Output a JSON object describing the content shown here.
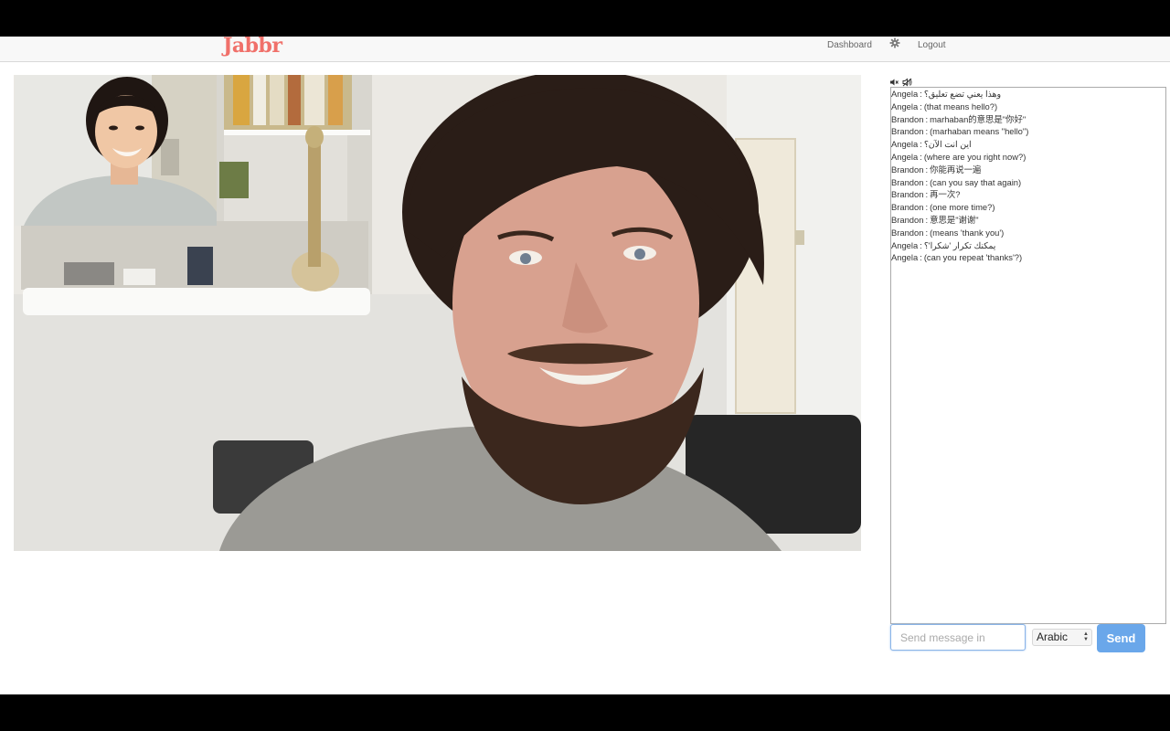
{
  "app": {
    "brand": "Jabbr"
  },
  "nav": {
    "dashboard": "Dashboard",
    "settings_icon": "gear-icon",
    "logout": "Logout"
  },
  "audio_controls": {
    "mute_icon": "speaker-mute-icon",
    "video_icon": "video-off-icon"
  },
  "chat": {
    "messages": [
      {
        "sender": "Angela",
        "text": "وهذا يعني تضع تعليق؟"
      },
      {
        "sender": "Angela",
        "text": "(that means hello?)"
      },
      {
        "sender": "Brandon",
        "text": "marhaban的意思是\"你好\""
      },
      {
        "sender": "Brandon",
        "text": "(marhaban means \"hello\")"
      },
      {
        "sender": "Angela",
        "text": "اين انت الآن؟"
      },
      {
        "sender": "Angela",
        "text": "(where are you right now?)"
      },
      {
        "sender": "Brandon",
        "text": "你能再说一遍"
      },
      {
        "sender": "Brandon",
        "text": "(can you say that again)"
      },
      {
        "sender": "Brandon",
        "text": "再一次?"
      },
      {
        "sender": "Brandon",
        "text": "(one more time?)"
      },
      {
        "sender": "Brandon",
        "text": "意思是\"谢谢\""
      },
      {
        "sender": "Brandon",
        "text": "(means 'thank you')"
      },
      {
        "sender": "Angela",
        "text": "يمكنك تكرار 'شكرا'؟"
      },
      {
        "sender": "Angela",
        "text": "(can you repeat 'thanks'?)"
      }
    ],
    "separator": ":"
  },
  "composer": {
    "placeholder": "Send message in",
    "value": "",
    "language": "Arabic",
    "send_label": "Send"
  },
  "colors": {
    "brand": "#f0706a",
    "send_button": "#6aa7ea",
    "input_focus": "#8ab4e8"
  }
}
